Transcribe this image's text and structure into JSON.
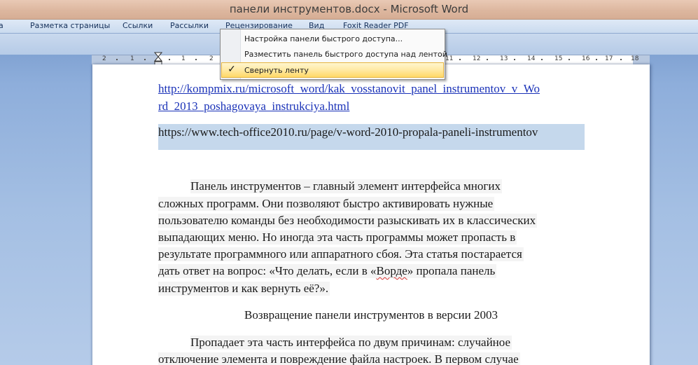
{
  "window": {
    "title": "панели инструментов.docx - Microsoft Word"
  },
  "ribbon": {
    "tabs": [
      {
        "label": "а"
      },
      {
        "label": "Разметка страницы"
      },
      {
        "label": "Ссылки"
      },
      {
        "label": "Рассылки"
      },
      {
        "label": "Рецензирование"
      },
      {
        "label": "Вид"
      },
      {
        "label": "Foxit Reader PDF"
      }
    ]
  },
  "ruler": {
    "labels": [
      "2",
      "1",
      "1",
      "2",
      "11",
      "12",
      "13",
      "14",
      "15",
      "16",
      "17",
      "18"
    ]
  },
  "context_menu": {
    "items": [
      {
        "label": "Настройка панели быстрого доступа...",
        "checked": false
      },
      {
        "label": "Разместить панель быстрого доступа над лентой",
        "checked": false
      },
      {
        "label": "Свернуть ленту",
        "checked": true
      }
    ],
    "check_glyph": "✓"
  },
  "document": {
    "link_lines": [
      "http://kompmix.ru/microsoft_word/kak_vosstanovit_panel_instrumentov_v_Wo",
      "rd_2013_poshagovaya_instrukciya.html"
    ],
    "plain_url": "https://www.tech-office2010.ru/page/v-word-2010-propala-paneli-instrumentov",
    "paragraph1_lines": [
      "Панель инструментов – главный элемент  интерфейса  многих",
      "сложных программ. Они позволяют быстро активировать нужные",
      "пользователю команды без необходимости разыскивать их в классических",
      "выпадающих меню. Но иногда эта часть программы может пропасть в",
      "результате программного или аппаратного сбоя. Эта статья постарается",
      "инструментов и как вернуть её?»."
    ],
    "paragraph1_line6_before": "дать ответ на вопрос: «Что делать, если в «",
    "paragraph1_line6_word": "Ворде",
    "paragraph1_line6_after": "» пропала панель",
    "heading": "Возвращение панели инструментов в версии 2003",
    "paragraph2_lines": [
      "Пропадает эта часть интерфейса по двум причинам: случайное",
      "отключение элемента и повреждение файла настроек. В первом случае"
    ]
  }
}
